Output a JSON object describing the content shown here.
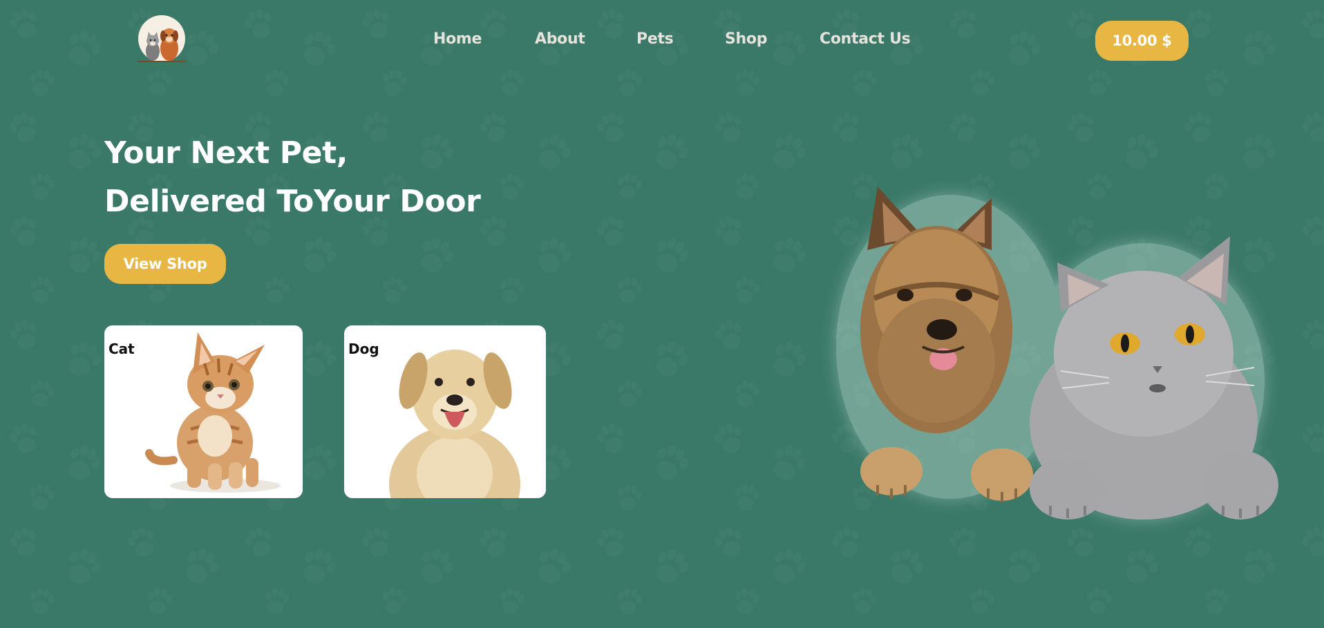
{
  "logo": {
    "icon": "cat-dog-logo-icon"
  },
  "nav": {
    "items": [
      {
        "label": "Home"
      },
      {
        "label": "About"
      },
      {
        "label": "Pets"
      },
      {
        "label": "Shop"
      },
      {
        "label": "Contact Us"
      }
    ]
  },
  "cart": {
    "total": "10.00 $"
  },
  "hero": {
    "title_line1": "Your Next Pet,",
    "title_line2": "Delivered ToYour Door",
    "cta_label": "View Shop",
    "image": "dog-and-cat-peeking-image"
  },
  "categories": [
    {
      "label": "Cat",
      "image": "kitten-photo"
    },
    {
      "label": "Dog",
      "image": "puppy-photo"
    }
  ],
  "colors": {
    "background": "#3a7868",
    "accent": "#e8b743",
    "nav_text": "#e6e3dd",
    "hero_text": "#ffffff"
  }
}
